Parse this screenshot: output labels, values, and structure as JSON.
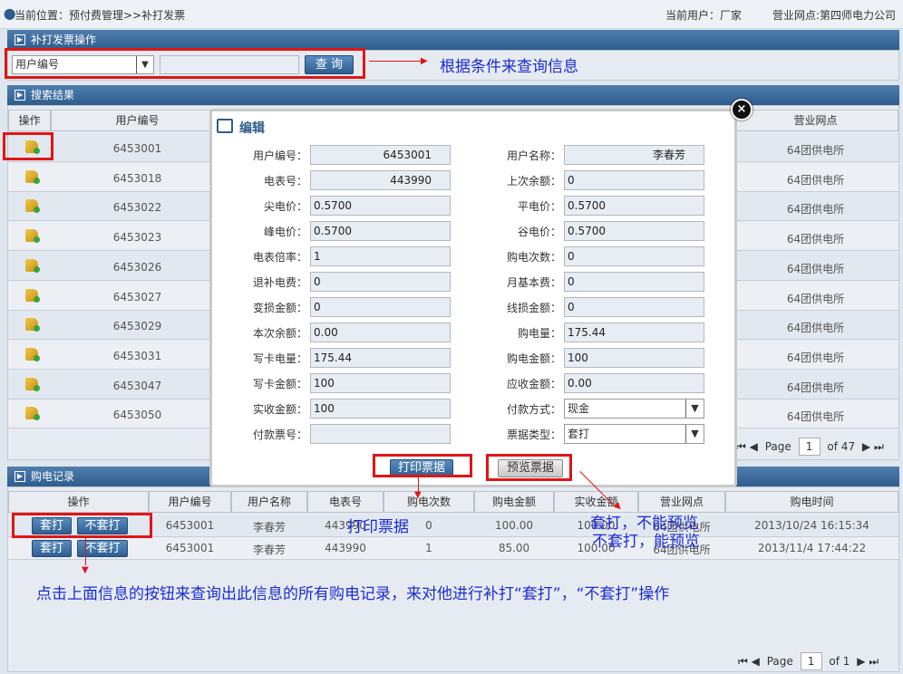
{
  "top": {
    "location": "当前位置：预付费管理>>补打发票",
    "current_user": "当前用户：厂家",
    "outlet": "营业网点:第四师电力公司"
  },
  "ops_section": {
    "title": "补打发票操作",
    "select_value": "用户编号",
    "input_value": "",
    "query_btn": "查 询"
  },
  "ops_note": "根据条件来查询信息",
  "results_section": {
    "title": "搜索结果"
  },
  "results": {
    "headers": {
      "op": "操作",
      "user_no": "用户编号",
      "outlet": "营业网点"
    },
    "rows": [
      {
        "user_no": "6453001",
        "outlet": "64团供电所"
      },
      {
        "user_no": "6453018",
        "outlet": "64团供电所"
      },
      {
        "user_no": "6453022",
        "outlet": "64团供电所"
      },
      {
        "user_no": "6453023",
        "outlet": "64团供电所"
      },
      {
        "user_no": "6453026",
        "outlet": "64团供电所"
      },
      {
        "user_no": "6453027",
        "outlet": "64团供电所"
      },
      {
        "user_no": "6453029",
        "outlet": "64团供电所"
      },
      {
        "user_no": "6453031",
        "outlet": "64团供电所"
      },
      {
        "user_no": "6453047",
        "outlet": "64团供电所"
      },
      {
        "user_no": "6453050",
        "outlet": "64团供电所"
      }
    ],
    "pager": {
      "page_label": "Page",
      "page": "1",
      "of": "of 47"
    }
  },
  "modal": {
    "title": "编辑",
    "left": [
      {
        "label": "用户编号：",
        "value": "6453001",
        "align": "right"
      },
      {
        "label": "电表号：",
        "value": "443990",
        "align": "right"
      },
      {
        "label": "尖电价：",
        "value": "0.5700"
      },
      {
        "label": "峰电价：",
        "value": "0.5700"
      },
      {
        "label": "电表倍率：",
        "value": "1"
      },
      {
        "label": "退补电费：",
        "value": "0"
      },
      {
        "label": "变损金额：",
        "value": "0"
      },
      {
        "label": "本次余额：",
        "value": "0.00"
      },
      {
        "label": "写卡电量：",
        "value": "175.44"
      },
      {
        "label": "写卡金额：",
        "value": "100"
      },
      {
        "label": "实收金额：",
        "value": "100"
      },
      {
        "label": "付款票号：",
        "value": ""
      }
    ],
    "right": [
      {
        "label": "用户名称：",
        "value": "李春芳",
        "align": "right"
      },
      {
        "label": "上次余额：",
        "value": "0"
      },
      {
        "label": "平电价：",
        "value": "0.5700"
      },
      {
        "label": "谷电价：",
        "value": "0.5700"
      },
      {
        "label": "购电次数：",
        "value": "0"
      },
      {
        "label": "月基本费：",
        "value": "0"
      },
      {
        "label": "线损金额：",
        "value": "0"
      },
      {
        "label": "购电量：",
        "value": "175.44"
      },
      {
        "label": "购电金额：",
        "value": "100"
      },
      {
        "label": "应收金额：",
        "value": "0.00"
      },
      {
        "label": "付款方式：",
        "value": "现金",
        "select": true
      },
      {
        "label": "票据类型：",
        "value": "套打",
        "select": true
      }
    ],
    "print_btn": "打印票据",
    "preview_btn": "预览票据"
  },
  "purchase_section": {
    "title": "购电记录"
  },
  "purchase": {
    "headers": [
      "操作",
      "用户编号",
      "用户名称",
      "电表号",
      "购电次数",
      "购电金额",
      "实收金额",
      "营业网点",
      "购电时间"
    ],
    "btn_tao": "套打",
    "btn_butao": "不套打",
    "rows": [
      [
        "6453001",
        "李春芳",
        "443990",
        "0",
        "100.00",
        "100.00",
        "64团供电所",
        "2013/10/24 16:15:34"
      ],
      [
        "6453001",
        "李春芳",
        "443990",
        "1",
        "85.00",
        "100.00",
        "64团供电所",
        "2013/11/4 17:44:22"
      ]
    ],
    "pager": {
      "page_label": "Page",
      "page": "1",
      "of": "of 1"
    }
  },
  "notes": {
    "print": "打印票据",
    "tao_no_preview": "套打，不能预览",
    "butao_preview": "不套打，能预览",
    "bottom": "点击上面信息的按钮来查询出此信息的所有购电记录，来对他进行补打“套打”，“不套打”操作"
  }
}
